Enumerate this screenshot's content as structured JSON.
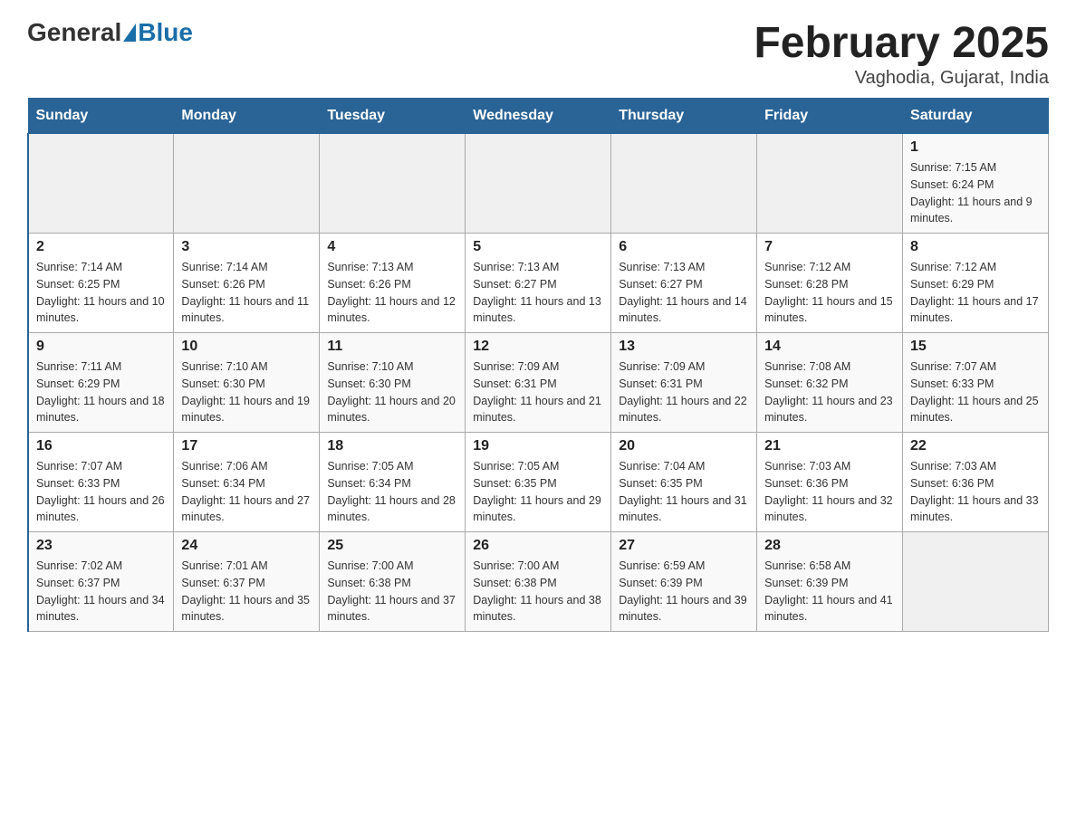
{
  "header": {
    "logo_general": "General",
    "logo_blue": "Blue",
    "month_title": "February 2025",
    "location": "Vaghodia, Gujarat, India"
  },
  "weekdays": [
    "Sunday",
    "Monday",
    "Tuesday",
    "Wednesday",
    "Thursday",
    "Friday",
    "Saturday"
  ],
  "weeks": [
    [
      {
        "day": "",
        "info": ""
      },
      {
        "day": "",
        "info": ""
      },
      {
        "day": "",
        "info": ""
      },
      {
        "day": "",
        "info": ""
      },
      {
        "day": "",
        "info": ""
      },
      {
        "day": "",
        "info": ""
      },
      {
        "day": "1",
        "info": "Sunrise: 7:15 AM\nSunset: 6:24 PM\nDaylight: 11 hours and 9 minutes."
      }
    ],
    [
      {
        "day": "2",
        "info": "Sunrise: 7:14 AM\nSunset: 6:25 PM\nDaylight: 11 hours and 10 minutes."
      },
      {
        "day": "3",
        "info": "Sunrise: 7:14 AM\nSunset: 6:26 PM\nDaylight: 11 hours and 11 minutes."
      },
      {
        "day": "4",
        "info": "Sunrise: 7:13 AM\nSunset: 6:26 PM\nDaylight: 11 hours and 12 minutes."
      },
      {
        "day": "5",
        "info": "Sunrise: 7:13 AM\nSunset: 6:27 PM\nDaylight: 11 hours and 13 minutes."
      },
      {
        "day": "6",
        "info": "Sunrise: 7:13 AM\nSunset: 6:27 PM\nDaylight: 11 hours and 14 minutes."
      },
      {
        "day": "7",
        "info": "Sunrise: 7:12 AM\nSunset: 6:28 PM\nDaylight: 11 hours and 15 minutes."
      },
      {
        "day": "8",
        "info": "Sunrise: 7:12 AM\nSunset: 6:29 PM\nDaylight: 11 hours and 17 minutes."
      }
    ],
    [
      {
        "day": "9",
        "info": "Sunrise: 7:11 AM\nSunset: 6:29 PM\nDaylight: 11 hours and 18 minutes."
      },
      {
        "day": "10",
        "info": "Sunrise: 7:10 AM\nSunset: 6:30 PM\nDaylight: 11 hours and 19 minutes."
      },
      {
        "day": "11",
        "info": "Sunrise: 7:10 AM\nSunset: 6:30 PM\nDaylight: 11 hours and 20 minutes."
      },
      {
        "day": "12",
        "info": "Sunrise: 7:09 AM\nSunset: 6:31 PM\nDaylight: 11 hours and 21 minutes."
      },
      {
        "day": "13",
        "info": "Sunrise: 7:09 AM\nSunset: 6:31 PM\nDaylight: 11 hours and 22 minutes."
      },
      {
        "day": "14",
        "info": "Sunrise: 7:08 AM\nSunset: 6:32 PM\nDaylight: 11 hours and 23 minutes."
      },
      {
        "day": "15",
        "info": "Sunrise: 7:07 AM\nSunset: 6:33 PM\nDaylight: 11 hours and 25 minutes."
      }
    ],
    [
      {
        "day": "16",
        "info": "Sunrise: 7:07 AM\nSunset: 6:33 PM\nDaylight: 11 hours and 26 minutes."
      },
      {
        "day": "17",
        "info": "Sunrise: 7:06 AM\nSunset: 6:34 PM\nDaylight: 11 hours and 27 minutes."
      },
      {
        "day": "18",
        "info": "Sunrise: 7:05 AM\nSunset: 6:34 PM\nDaylight: 11 hours and 28 minutes."
      },
      {
        "day": "19",
        "info": "Sunrise: 7:05 AM\nSunset: 6:35 PM\nDaylight: 11 hours and 29 minutes."
      },
      {
        "day": "20",
        "info": "Sunrise: 7:04 AM\nSunset: 6:35 PM\nDaylight: 11 hours and 31 minutes."
      },
      {
        "day": "21",
        "info": "Sunrise: 7:03 AM\nSunset: 6:36 PM\nDaylight: 11 hours and 32 minutes."
      },
      {
        "day": "22",
        "info": "Sunrise: 7:03 AM\nSunset: 6:36 PM\nDaylight: 11 hours and 33 minutes."
      }
    ],
    [
      {
        "day": "23",
        "info": "Sunrise: 7:02 AM\nSunset: 6:37 PM\nDaylight: 11 hours and 34 minutes."
      },
      {
        "day": "24",
        "info": "Sunrise: 7:01 AM\nSunset: 6:37 PM\nDaylight: 11 hours and 35 minutes."
      },
      {
        "day": "25",
        "info": "Sunrise: 7:00 AM\nSunset: 6:38 PM\nDaylight: 11 hours and 37 minutes."
      },
      {
        "day": "26",
        "info": "Sunrise: 7:00 AM\nSunset: 6:38 PM\nDaylight: 11 hours and 38 minutes."
      },
      {
        "day": "27",
        "info": "Sunrise: 6:59 AM\nSunset: 6:39 PM\nDaylight: 11 hours and 39 minutes."
      },
      {
        "day": "28",
        "info": "Sunrise: 6:58 AM\nSunset: 6:39 PM\nDaylight: 11 hours and 41 minutes."
      },
      {
        "day": "",
        "info": ""
      }
    ]
  ]
}
